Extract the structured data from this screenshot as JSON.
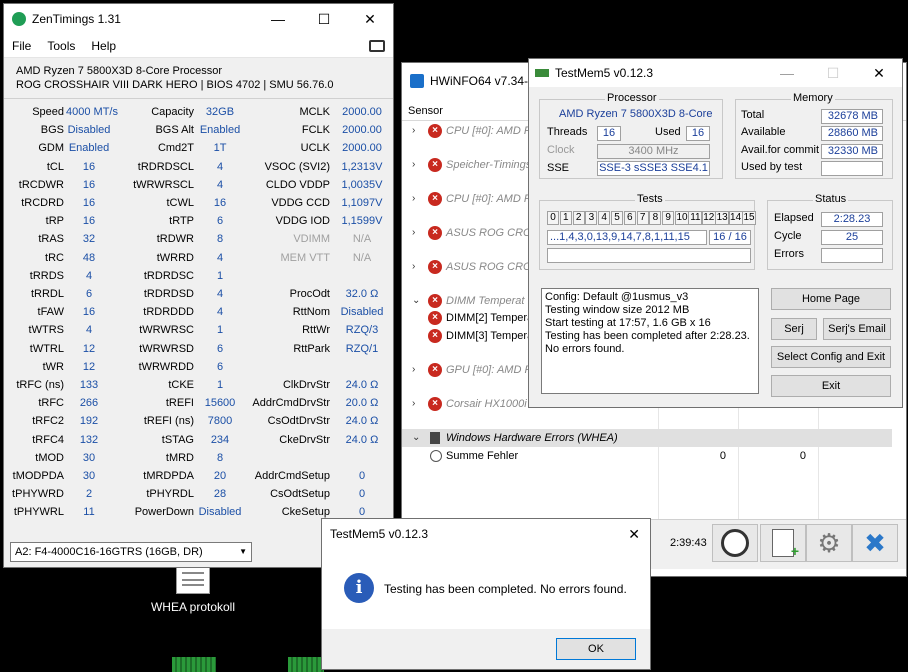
{
  "desktop": {
    "icon_label": "WHEA protokoll"
  },
  "zentimings": {
    "title": "ZenTimings 1.31",
    "menu": [
      "File",
      "Tools",
      "Help"
    ],
    "cpu": "AMD Ryzen 7 5800X3D 8-Core Processor",
    "board": "ROG CROSSHAIR VIII DARK HERO | BIOS 4702 | SMU 56.76.0",
    "dimm": "A2: F4-4000C16-16GTRS (16GB, DR)",
    "rows": [
      [
        [
          "Speed",
          "4000 MT/s"
        ],
        [
          "Capacity",
          "32GB"
        ],
        [
          "MCLK",
          "2000.00"
        ]
      ],
      [
        [
          "BGS",
          "Disabled"
        ],
        [
          "BGS Alt",
          "Enabled"
        ],
        [
          "FCLK",
          "2000.00"
        ]
      ],
      [
        [
          "GDM",
          "Enabled"
        ],
        [
          "Cmd2T",
          "1T"
        ],
        [
          "UCLK",
          "2000.00"
        ]
      ],
      [
        [
          "tCL",
          "16"
        ],
        [
          "tRDRDSCL",
          "4"
        ],
        [
          "VSOC (SVI2)",
          "1,2313V"
        ]
      ],
      [
        [
          "tRCDWR",
          "16"
        ],
        [
          "tWRWRSCL",
          "4"
        ],
        [
          "CLDO VDDP",
          "1,0035V"
        ]
      ],
      [
        [
          "tRCDRD",
          "16"
        ],
        [
          "tCWL",
          "16"
        ],
        [
          "VDDG CCD",
          "1,1097V"
        ]
      ],
      [
        [
          "tRP",
          "16"
        ],
        [
          "tRTP",
          "6"
        ],
        [
          "VDDG IOD",
          "1,1599V"
        ]
      ],
      [
        [
          "tRAS",
          "32"
        ],
        [
          "tRDWR",
          "8"
        ],
        [
          "VDIMM",
          "N/A"
        ]
      ],
      [
        [
          "tRC",
          "48"
        ],
        [
          "tWRRD",
          "4"
        ],
        [
          "MEM VTT",
          "N/A"
        ]
      ],
      [
        [
          "tRRDS",
          "4"
        ],
        [
          "tRDRDSC",
          "1"
        ],
        [
          "",
          ""
        ]
      ],
      [
        [
          "tRRDL",
          "6"
        ],
        [
          "tRDRDSD",
          "4"
        ],
        [
          "ProcOdt",
          "32.0 Ω"
        ]
      ],
      [
        [
          "tFAW",
          "16"
        ],
        [
          "tRDRDDD",
          "4"
        ],
        [
          "RttNom",
          "Disabled"
        ]
      ],
      [
        [
          "tWTRS",
          "4"
        ],
        [
          "tWRWRSC",
          "1"
        ],
        [
          "RttWr",
          "RZQ/3"
        ]
      ],
      [
        [
          "tWTRL",
          "12"
        ],
        [
          "tWRWRSD",
          "6"
        ],
        [
          "RttPark",
          "RZQ/1"
        ]
      ],
      [
        [
          "tWR",
          "12"
        ],
        [
          "tWRWRDD",
          "6"
        ],
        [
          "",
          ""
        ]
      ],
      [
        [
          "tRFC (ns)",
          "133"
        ],
        [
          "tCKE",
          "1"
        ],
        [
          "ClkDrvStr",
          "24.0 Ω"
        ]
      ],
      [
        [
          "tRFC",
          "266"
        ],
        [
          "tREFI",
          "15600"
        ],
        [
          "AddrCmdDrvStr",
          "20.0 Ω"
        ]
      ],
      [
        [
          "tRFC2",
          "192"
        ],
        [
          "tREFI (ns)",
          "7800"
        ],
        [
          "CsOdtDrvStr",
          "24.0 Ω"
        ]
      ],
      [
        [
          "tRFC4",
          "132"
        ],
        [
          "tSTAG",
          "234"
        ],
        [
          "CkeDrvStr",
          "24.0 Ω"
        ]
      ],
      [
        [
          "tMOD",
          "30"
        ],
        [
          "tMRD",
          "8"
        ],
        [
          "",
          ""
        ]
      ],
      [
        [
          "tMODPDA",
          "30"
        ],
        [
          "tMRDPDA",
          "20"
        ],
        [
          "AddrCmdSetup",
          "0"
        ]
      ],
      [
        [
          "tPHYWRD",
          "2"
        ],
        [
          "tPHYRDL",
          "28"
        ],
        [
          "CsOdtSetup",
          "0"
        ]
      ],
      [
        [
          "tPHYWRL",
          "11"
        ],
        [
          "PowerDown",
          "Disabled"
        ],
        [
          "CkeSetup",
          "0"
        ]
      ]
    ]
  },
  "hwinfo": {
    "title": "HWiNFO64 v7.34-4",
    "header_sensor": "Sensor",
    "rows": [
      {
        "name": "CPU [#0]: AMD R",
        "type": "collapsed"
      },
      {
        "name": "Speicher-Timings",
        "type": "collapsed"
      },
      {
        "name": "CPU [#0]: AMD R",
        "type": "collapsed"
      },
      {
        "name": "ASUS ROG CROS",
        "type": "collapsed"
      },
      {
        "name": "ASUS ROG CROS",
        "type": "collapsed"
      },
      {
        "name": "DIMM Temperat",
        "type": "expanded"
      },
      {
        "name": "DIMM[2] Tempera",
        "type": "child"
      },
      {
        "name": "DIMM[3] Tempera",
        "type": "child"
      },
      {
        "name": "GPU [#0]: AMD R",
        "type": "collapsed"
      },
      {
        "name": "Corsair HX1000i",
        "type": "collapsed"
      }
    ],
    "whea_group": "Windows Hardware Errors (WHEA)",
    "whea_item": "Summe Fehler",
    "whea_val1": "0",
    "whea_val2": "0",
    "elapsed": "2:39:43"
  },
  "testmem": {
    "title": "TestMem5 v0.12.3",
    "processor_group": "Processor",
    "cpu": "AMD Ryzen 7 5800X3D 8-Core",
    "threads_label": "Threads",
    "threads": "16",
    "used_label": "Used",
    "used": "16",
    "clock_label": "Clock",
    "clock": "3400 MHz",
    "sse_label": "SSE",
    "sse": "SSE-3 sSSE3 SSE4.1",
    "memory_group": "Memory",
    "total_label": "Total",
    "total": "32678 MB",
    "available_label": "Available",
    "available": "28860 MB",
    "commit_label": "Avail.for commit",
    "commit": "32330 MB",
    "usedbytest_label": "Used by test",
    "usedbytest": "",
    "tests_group": "Tests",
    "tests": [
      "0",
      "1",
      "2",
      "3",
      "4",
      "5",
      "6",
      "7",
      "8",
      "9",
      "10",
      "11",
      "12",
      "13",
      "14",
      "15"
    ],
    "sequence": "...1,4,3,0,13,9,14,7,8,1,11,15",
    "progress": "16 / 16",
    "status_group": "Status",
    "elapsed_label": "Elapsed",
    "elapsed": "2:28.23",
    "cycle_label": "Cycle",
    "cycle": "25",
    "errors_label": "Errors",
    "errors": "",
    "log": [
      "Config: Default @1usmus_v3",
      "Testing window size 2012 MB",
      "Start testing at 17:57, 1.6 GB x 16",
      "Testing has been completed after 2:28.23.",
      "No errors found."
    ],
    "buttons": {
      "home": "Home Page",
      "serj": "Serj",
      "email": "Serj's Email",
      "select": "Select Config and Exit",
      "exit": "Exit"
    }
  },
  "dialog": {
    "title": "TestMem5 v0.12.3",
    "message": "Testing has been completed. No errors found.",
    "ok": "OK"
  }
}
